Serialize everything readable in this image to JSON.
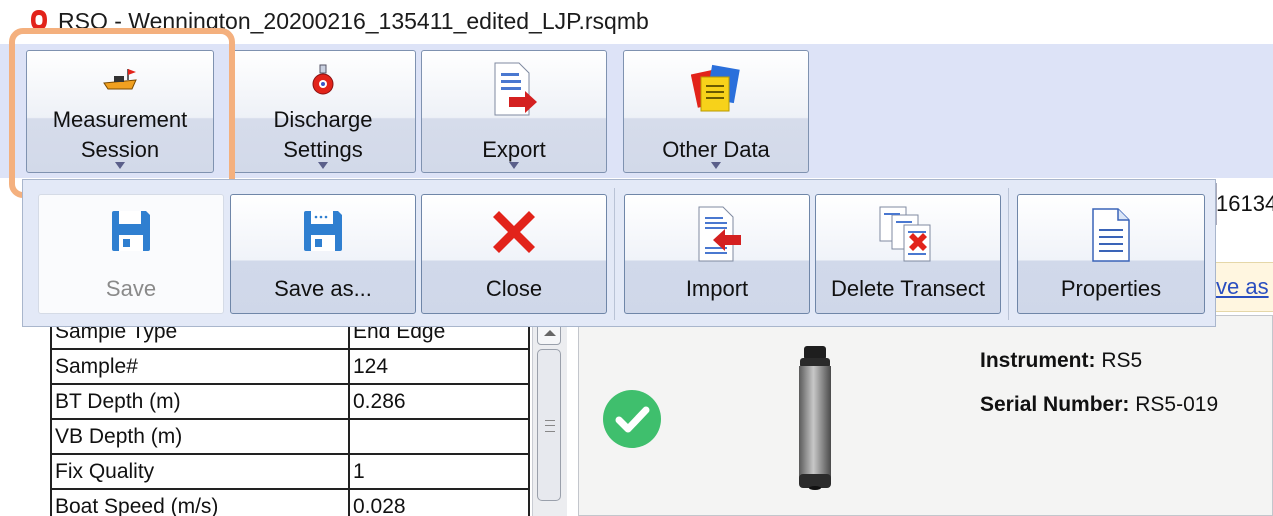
{
  "window": {
    "title": "RSQ - Wennington_20200216_135411_edited_LJP.rsqmb"
  },
  "ribbon": {
    "buttons": [
      {
        "label_line1": "Measurement",
        "label_line2": "Session",
        "icon": "boat-icon"
      },
      {
        "label_line1": "Discharge",
        "label_line2": "Settings",
        "icon": "settings-icon"
      },
      {
        "label_line1": "",
        "label_line2": "Export",
        "icon": "export-icon"
      },
      {
        "label_line1": "",
        "label_line2": "Other Data",
        "icon": "notes-icon"
      }
    ]
  },
  "dropdown": {
    "items": [
      {
        "label": "Save",
        "icon": "save-icon",
        "enabled": false
      },
      {
        "label": "Save as...",
        "icon": "save-as-icon",
        "enabled": true
      },
      {
        "label": "Close",
        "icon": "close-icon",
        "enabled": true
      },
      {
        "label": "Import",
        "icon": "import-icon",
        "enabled": true
      },
      {
        "label": "Delete Transect",
        "icon": "delete-transect-icon",
        "enabled": true
      },
      {
        "label": "Properties",
        "icon": "properties-icon",
        "enabled": true
      }
    ]
  },
  "background": {
    "partial_number": "16134",
    "partial_link": "ve as"
  },
  "table": {
    "rows": [
      {
        "key": "Sample Type",
        "value": "End Edge"
      },
      {
        "key": "Sample#",
        "value": "124"
      },
      {
        "key": "BT Depth (m)",
        "value": "0.286"
      },
      {
        "key": "VB Depth (m)",
        "value": ""
      },
      {
        "key": "Fix Quality",
        "value": "1"
      },
      {
        "key": "Boat Speed (m/s)",
        "value": "0.028"
      }
    ]
  },
  "instrument": {
    "instrument_label": "Instrument:",
    "instrument_value": "RS5",
    "serial_label": "Serial Number:",
    "serial_value": "RS5-019",
    "status": "ok"
  },
  "colors": {
    "ribbon_bg": "#dde3f7",
    "highlight": "#f4b07e",
    "accent_red": "#e2231a",
    "check_green": "#3fbf6d"
  }
}
